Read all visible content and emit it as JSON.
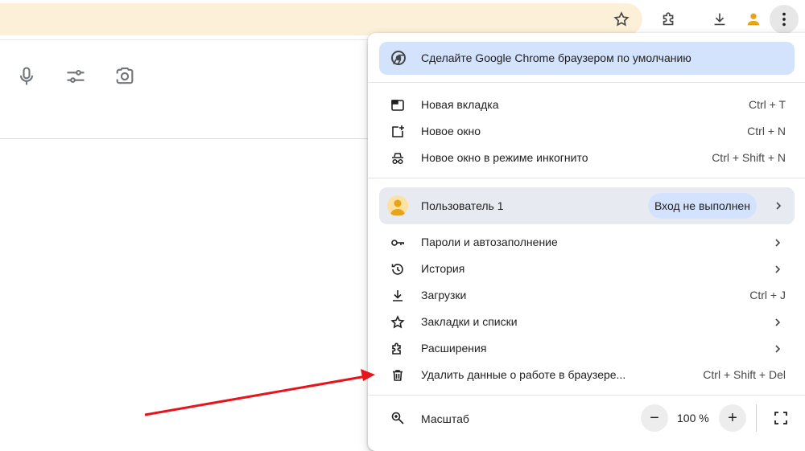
{
  "menu": {
    "default_banner": "Сделайте Google Chrome браузером по умолчанию",
    "items_group1": [
      {
        "label": "Новая вкладка",
        "shortcut": "Ctrl + T"
      },
      {
        "label": "Новое окно",
        "shortcut": "Ctrl + N"
      },
      {
        "label": "Новое окно в режиме инкогнито",
        "shortcut": "Ctrl + Shift + N"
      }
    ],
    "profile": {
      "name": "Пользователь 1",
      "status": "Вход не выполнен"
    },
    "items_group2": [
      {
        "label": "Пароли и автозаполнение"
      },
      {
        "label": "История"
      },
      {
        "label": "Загрузки",
        "shortcut": "Ctrl + J"
      },
      {
        "label": "Закладки и списки"
      },
      {
        "label": "Расширения"
      },
      {
        "label": "Удалить данные о работе в браузере...",
        "shortcut": "Ctrl + Shift + Del"
      }
    ],
    "zoom": {
      "label": "Масштаб",
      "minus": "−",
      "value": "100 %",
      "plus": "+"
    }
  },
  "colors": {
    "omnibox": "#fdf0d9",
    "banner": "#d3e3fd",
    "profile_bg": "#e8eaf2",
    "avatar": "#e8a317",
    "arrow": "#e8141c"
  }
}
